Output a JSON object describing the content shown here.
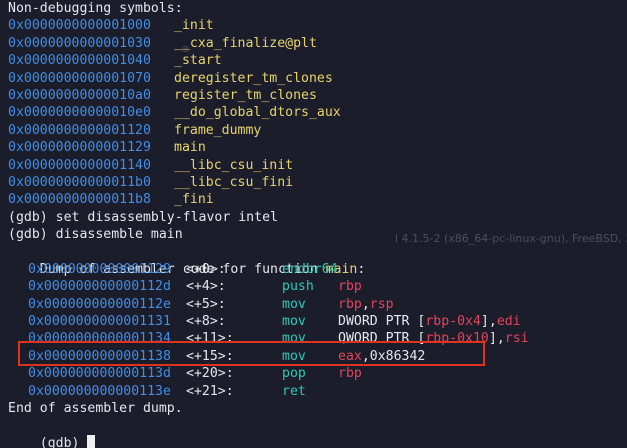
{
  "header": "Non-debugging symbols:",
  "symbols": [
    {
      "addr": "0x0000000000001000",
      "name": "_init"
    },
    {
      "addr": "0x0000000000001030",
      "name": "__cxa_finalize@plt"
    },
    {
      "addr": "0x0000000000001040",
      "name": "_start"
    },
    {
      "addr": "0x0000000000001070",
      "name": "deregister_tm_clones"
    },
    {
      "addr": "0x00000000000010a0",
      "name": "register_tm_clones"
    },
    {
      "addr": "0x00000000000010e0",
      "name": "__do_global_dtors_aux"
    },
    {
      "addr": "0x0000000000001120",
      "name": "frame_dummy"
    },
    {
      "addr": "0x0000000000001129",
      "name": "main"
    },
    {
      "addr": "0x0000000000001140",
      "name": "__libc_csu_init"
    },
    {
      "addr": "0x00000000000011b0",
      "name": "__libc_csu_fini"
    },
    {
      "addr": "0x00000000000011b8",
      "name": "_fini"
    }
  ],
  "commands": {
    "set_flavor": "(gdb) set disassembly-flavor intel",
    "disassemble": "(gdb) disassemble main"
  },
  "dump_header": {
    "prefix": "Dump of assembler code for function ",
    "function": "main",
    "suffix": ":"
  },
  "instructions": [
    {
      "addr": "0x0000000000001129",
      "offset": "<+0>:",
      "mnemonic": "endbr64",
      "operands": []
    },
    {
      "addr": "0x000000000000112d",
      "offset": "<+4>:",
      "mnemonic": "push",
      "operands": [
        {
          "t": "rbp",
          "k": "reg"
        }
      ]
    },
    {
      "addr": "0x000000000000112e",
      "offset": "<+5>:",
      "mnemonic": "mov",
      "operands": [
        {
          "t": "rbp",
          "k": "reg"
        },
        {
          "t": ",",
          "k": "txt"
        },
        {
          "t": "rsp",
          "k": "reg"
        }
      ]
    },
    {
      "addr": "0x0000000000001131",
      "offset": "<+8>:",
      "mnemonic": "mov",
      "operands": [
        {
          "t": "DWORD PTR [",
          "k": "txt"
        },
        {
          "t": "rbp-0x4",
          "k": "reg"
        },
        {
          "t": "],",
          "k": "txt"
        },
        {
          "t": "edi",
          "k": "reg"
        }
      ]
    },
    {
      "addr": "0x0000000000001134",
      "offset": "<+11>:",
      "mnemonic": "mov",
      "operands": [
        {
          "t": "QWORD PTR [",
          "k": "txt"
        },
        {
          "t": "rbp-0x10",
          "k": "reg"
        },
        {
          "t": "],",
          "k": "txt"
        },
        {
          "t": "rsi",
          "k": "reg"
        }
      ]
    },
    {
      "addr": "0x0000000000001138",
      "offset": "<+15>:",
      "mnemonic": "mov",
      "operands": [
        {
          "t": "eax",
          "k": "reg"
        },
        {
          "t": ",0x86342",
          "k": "txt"
        }
      ]
    },
    {
      "addr": "0x000000000000113d",
      "offset": "<+20>:",
      "mnemonic": "pop",
      "operands": [
        {
          "t": "rbp",
          "k": "reg"
        }
      ]
    },
    {
      "addr": "0x000000000000113e",
      "offset": "<+21>:",
      "mnemonic": "ret",
      "operands": []
    }
  ],
  "end_text": "End of assembler dump.",
  "prompt": "(gdb) ",
  "ghost_text": {
    "line1": "e",
    "line2": "l 4.1.5-2 (x86_64-pc-linux-gnu), FreeBSD, 36"
  },
  "colors": {
    "background": "#1b1d2b",
    "address": "#3f8ee8",
    "symbol": "#e8d36a",
    "mnemonic": "#2ec7b9",
    "register": "#e2445a",
    "highlight_border": "#e0331f"
  }
}
